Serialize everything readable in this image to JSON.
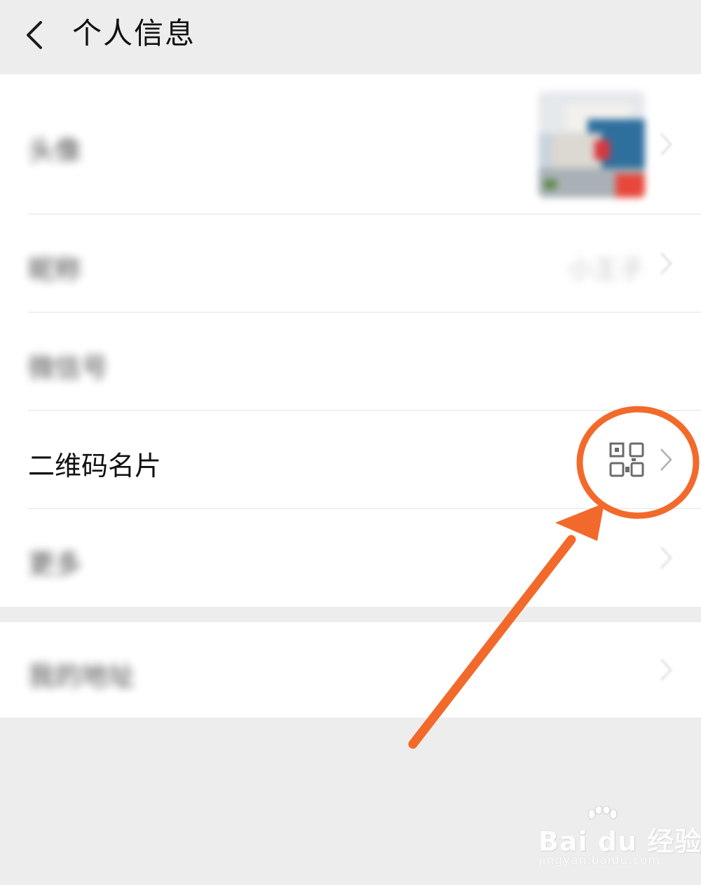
{
  "header": {
    "title": "个人信息",
    "back_icon": "chevron-left-icon"
  },
  "rows": {
    "avatar": {
      "label": "头像"
    },
    "nickname": {
      "label": "昵称",
      "value": "小王子"
    },
    "wechat_id": {
      "label": "微信号"
    },
    "qr_code": {
      "label": "二维码名片",
      "icon": "qr-code-icon"
    },
    "more": {
      "label": "更多"
    },
    "address": {
      "label": "我的地址"
    }
  },
  "annotation": {
    "color": "#f26a2b"
  },
  "watermark": {
    "main": "Bai du 经验",
    "sub": "jingyan.baidu.com"
  }
}
